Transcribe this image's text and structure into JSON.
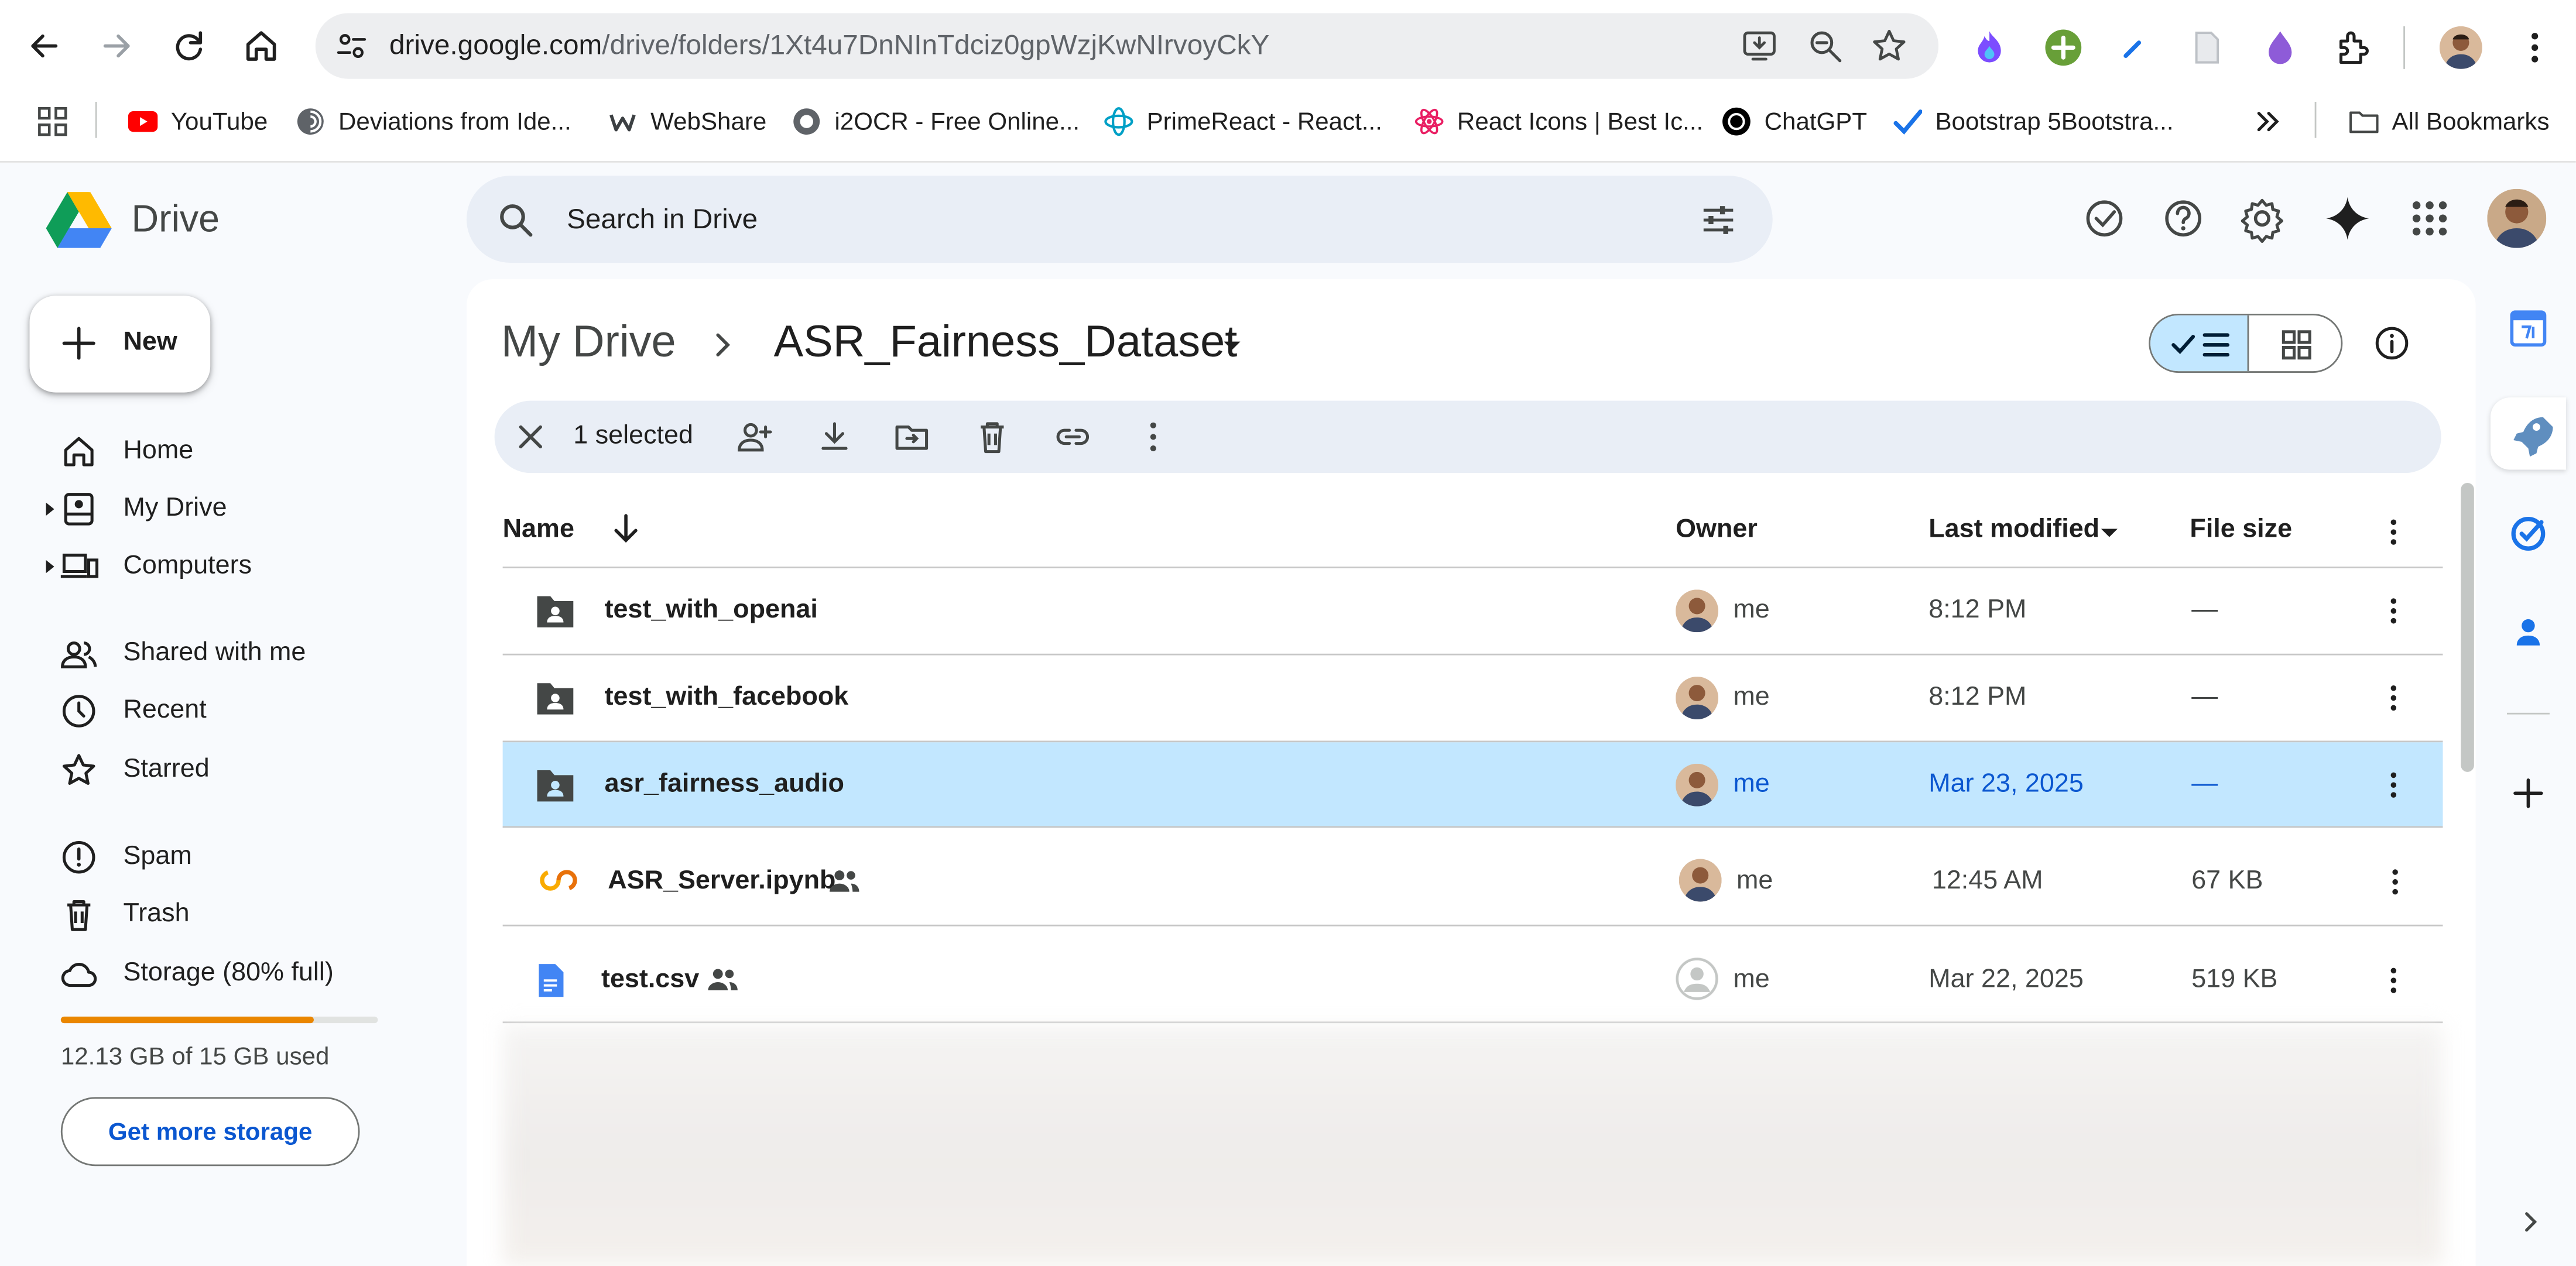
{
  "browser": {
    "url_host": "drive.google.com",
    "url_path": "/drive/folders/1Xt4u7DnNInTdciz0gpWzjKwNIrvoyCkY",
    "bookmarks": [
      {
        "label": "YouTube",
        "icon": "youtube-icon"
      },
      {
        "label": "Deviations from Ide...",
        "icon": "spiral-icon"
      },
      {
        "label": "WebShare",
        "icon": "webshare-icon"
      },
      {
        "label": "i2OCR - Free Online...",
        "icon": "ocr-icon"
      },
      {
        "label": "PrimeReact - React...",
        "icon": "primereact-icon"
      },
      {
        "label": "React Icons | Best Ic...",
        "icon": "react-icon"
      },
      {
        "label": "ChatGPT",
        "icon": "chatgpt-icon"
      },
      {
        "label": "Bootstrap 5Bootstra...",
        "icon": "check-icon"
      }
    ],
    "all_bookmarks": "All Bookmarks"
  },
  "drive": {
    "app_name": "Drive",
    "search_placeholder": "Search in Drive",
    "new_label": "New"
  },
  "sidebar": {
    "items": [
      {
        "label": "Home",
        "icon": "home-icon"
      },
      {
        "label": "My Drive",
        "icon": "my-drive-icon"
      },
      {
        "label": "Computers",
        "icon": "computers-icon"
      },
      {
        "label": "Shared with me",
        "icon": "shared-icon"
      },
      {
        "label": "Recent",
        "icon": "clock-icon"
      },
      {
        "label": "Starred",
        "icon": "star-icon"
      },
      {
        "label": "Spam",
        "icon": "spam-icon"
      },
      {
        "label": "Trash",
        "icon": "trash-icon"
      },
      {
        "label": "Storage (80% full)",
        "icon": "cloud-icon"
      }
    ],
    "storage_fraction": 0.8,
    "storage_used": "12.13 GB of 15 GB used",
    "get_more_storage": "Get more storage"
  },
  "main": {
    "breadcrumb_root": "My Drive",
    "breadcrumb_current": "ASR_Fairness_Dataset",
    "selection_count": "1 selected",
    "columns": {
      "name": "Name",
      "owner": "Owner",
      "last_modified": "Last modified",
      "file_size": "File size"
    },
    "rows": [
      {
        "name": "test_with_openai",
        "type": "shared-folder",
        "owner": "me",
        "modified": "8:12 PM",
        "size": "—",
        "selected": false
      },
      {
        "name": "test_with_facebook",
        "type": "shared-folder",
        "owner": "me",
        "modified": "8:12 PM",
        "size": "—",
        "selected": false
      },
      {
        "name": "asr_fairness_audio",
        "type": "shared-folder",
        "owner": "me",
        "modified": "Mar 23, 2025",
        "size": "—",
        "selected": true
      },
      {
        "name": "ASR_Server.ipynb",
        "type": "colab",
        "owner": "me",
        "modified": "12:45 AM",
        "size": "67 KB",
        "selected": false,
        "shared": true
      },
      {
        "name": "test.csv",
        "type": "doc",
        "owner": "me",
        "modified": "Mar 22, 2025",
        "size": "519 KB",
        "selected": false,
        "shared": true
      }
    ]
  },
  "colors": {
    "accent": "#0b57d0",
    "selected_row": "#c2e7ff",
    "storage_bar": "#ea8600"
  }
}
